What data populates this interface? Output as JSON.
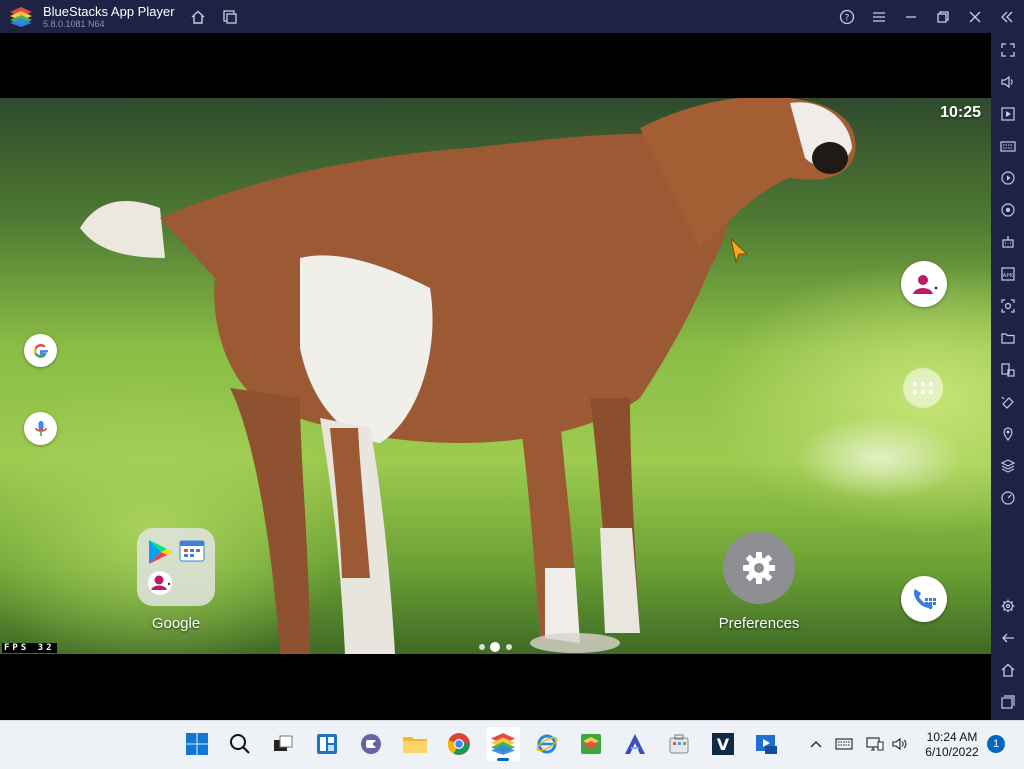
{
  "window": {
    "title": "BlueStacks App Player",
    "version": "5.8.0.1081 N64"
  },
  "android": {
    "clock": "10:25",
    "fps_label": "FPS   32",
    "folder_label": "Google",
    "preferences_label": "Preferences"
  },
  "taskbar": {
    "time": "10:24 AM",
    "date": "6/10/2022",
    "notification_count": "1"
  },
  "colors": {
    "titlebar": "#1e2244",
    "taskbar": "#eef1f6",
    "accent": "#0067c0"
  }
}
